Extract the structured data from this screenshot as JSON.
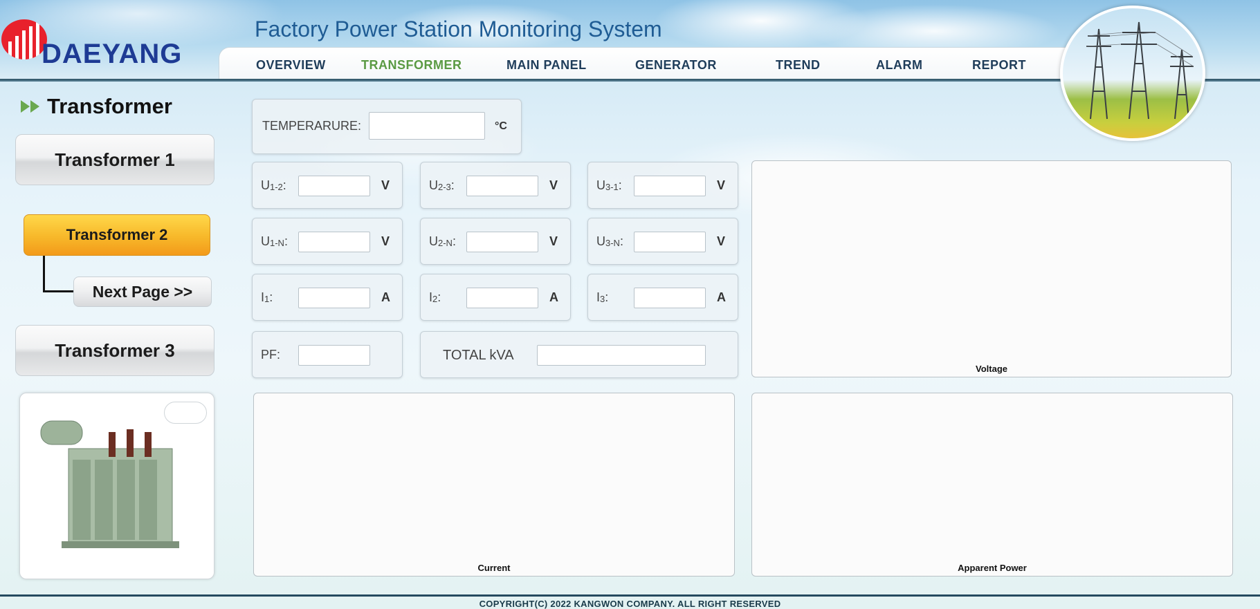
{
  "header": {
    "brand": "DAEYANG",
    "app_title": "Factory Power Station Monitoring System"
  },
  "nav": {
    "items": [
      {
        "label": "OVERVIEW",
        "active": false
      },
      {
        "label": "TRANSFORMER",
        "active": true
      },
      {
        "label": "MAIN PANEL",
        "active": false
      },
      {
        "label": "GENERATOR",
        "active": false
      },
      {
        "label": "TREND",
        "active": false
      },
      {
        "label": "ALARM",
        "active": false
      },
      {
        "label": "REPORT",
        "active": false
      }
    ],
    "active_color": "#5a9a43"
  },
  "sidebar": {
    "heading": "Transformer",
    "buttons": [
      {
        "label": "Transformer 1"
      },
      {
        "label": "Transformer 2",
        "active": true
      },
      {
        "label": "Transformer 3"
      }
    ],
    "next_page": "Next Page >>"
  },
  "readings": {
    "temperature": {
      "label": "TEMPERARURE:",
      "unit": "°C",
      "value": ""
    },
    "u12": {
      "label_main": "U",
      "label_sub": "1-2",
      "unit": "V",
      "value": ""
    },
    "u23": {
      "label_main": "U",
      "label_sub": "2-3",
      "unit": "V",
      "value": ""
    },
    "u31": {
      "label_main": "U",
      "label_sub": "3-1",
      "unit": "V",
      "value": ""
    },
    "u1n": {
      "label_main": "U",
      "label_sub": "1-N",
      "unit": "V",
      "value": ""
    },
    "u2n": {
      "label_main": "U",
      "label_sub": "2-N",
      "unit": "V",
      "value": ""
    },
    "u3n": {
      "label_main": "U",
      "label_sub": "3-N",
      "unit": "V",
      "value": ""
    },
    "i1": {
      "label_main": "I",
      "label_sub": "1",
      "unit": "A",
      "value": ""
    },
    "i2": {
      "label_main": "I",
      "label_sub": "2",
      "unit": "A",
      "value": ""
    },
    "i3": {
      "label_main": "I",
      "label_sub": "3",
      "unit": "A",
      "value": ""
    },
    "pf": {
      "label": "PF:",
      "value": ""
    },
    "total_kva": {
      "label": "TOTAL kVA",
      "value": ""
    }
  },
  "charts": {
    "voltage": "Voltage",
    "current": "Current",
    "apparent_power": "Apparent Power"
  },
  "footer": {
    "copyright": "COPYRIGHT(C) 2022 KANGWON COMPANY. ALL RIGHT RESERVED"
  },
  "colors": {
    "brand_red": "#e8212c",
    "brand_blue": "#1e3b94",
    "active_button": "#f7b82a"
  }
}
